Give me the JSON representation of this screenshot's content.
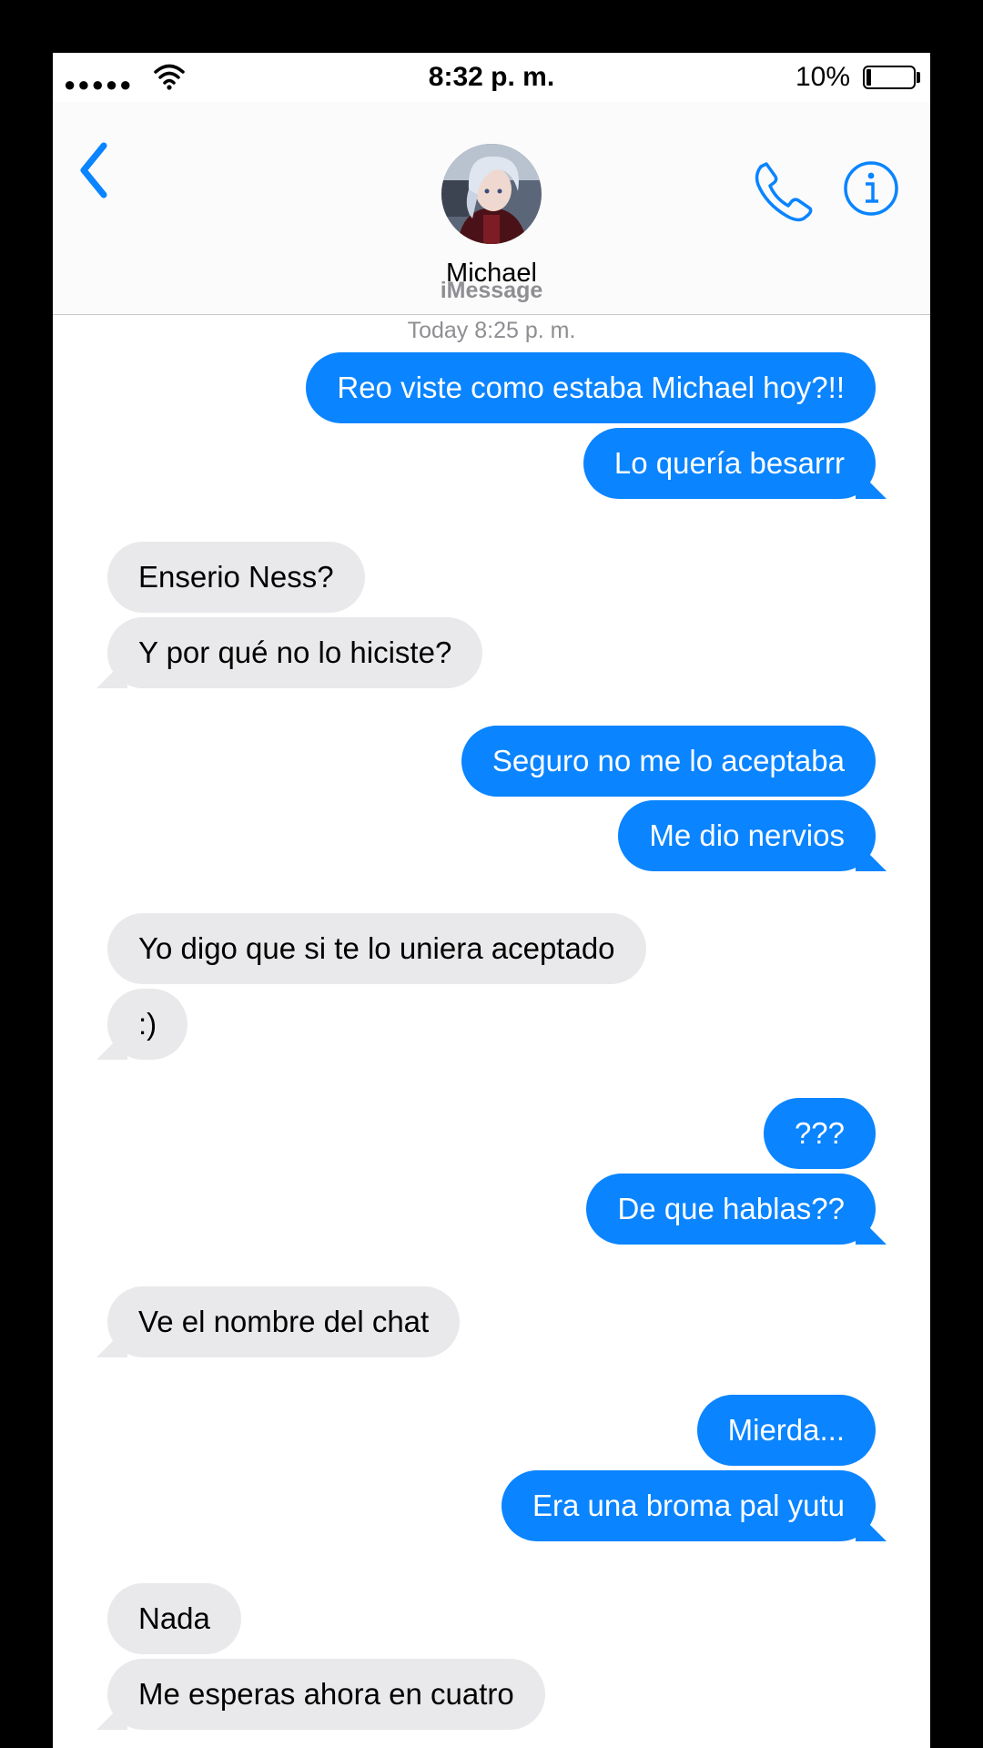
{
  "status_bar": {
    "signal": "●●●●●",
    "time": "8:32 p. m.",
    "battery_percent": "10%",
    "battery_level": 0.1
  },
  "header": {
    "contact_name": "Michael",
    "back_icon": "chevron-left-icon",
    "call_icon": "phone-icon",
    "info_icon": "info-icon"
  },
  "conversation": {
    "service_label": "iMessage",
    "timestamp": "Today 8:25 p. m.",
    "messages": [
      {
        "from": "me",
        "text": "Reo viste como estaba Michael hoy?!!"
      },
      {
        "from": "me",
        "text": "Lo quería besarrr"
      },
      {
        "from": "them",
        "text": "Enserio Ness?"
      },
      {
        "from": "them",
        "text": "Y por qué no lo hiciste?"
      },
      {
        "from": "me",
        "text": "Seguro no me lo aceptaba"
      },
      {
        "from": "me",
        "text": "Me dio nervios"
      },
      {
        "from": "them",
        "text": "Yo digo que si te lo uniera aceptado"
      },
      {
        "from": "them",
        "text": ":)"
      },
      {
        "from": "me",
        "text": "???"
      },
      {
        "from": "me",
        "text": "De que hablas??"
      },
      {
        "from": "them",
        "text": "Ve el nombre del chat"
      },
      {
        "from": "me",
        "text": "Mierda..."
      },
      {
        "from": "me",
        "text": "Era una broma pal yutu"
      },
      {
        "from": "them",
        "text": "Nada"
      },
      {
        "from": "them",
        "text": "Me esperas ahora en cuatro"
      }
    ]
  },
  "colors": {
    "accent": "#0a84ff",
    "incoming_bubble": "#e9e9eb",
    "meta_text": "#8e8e93"
  }
}
